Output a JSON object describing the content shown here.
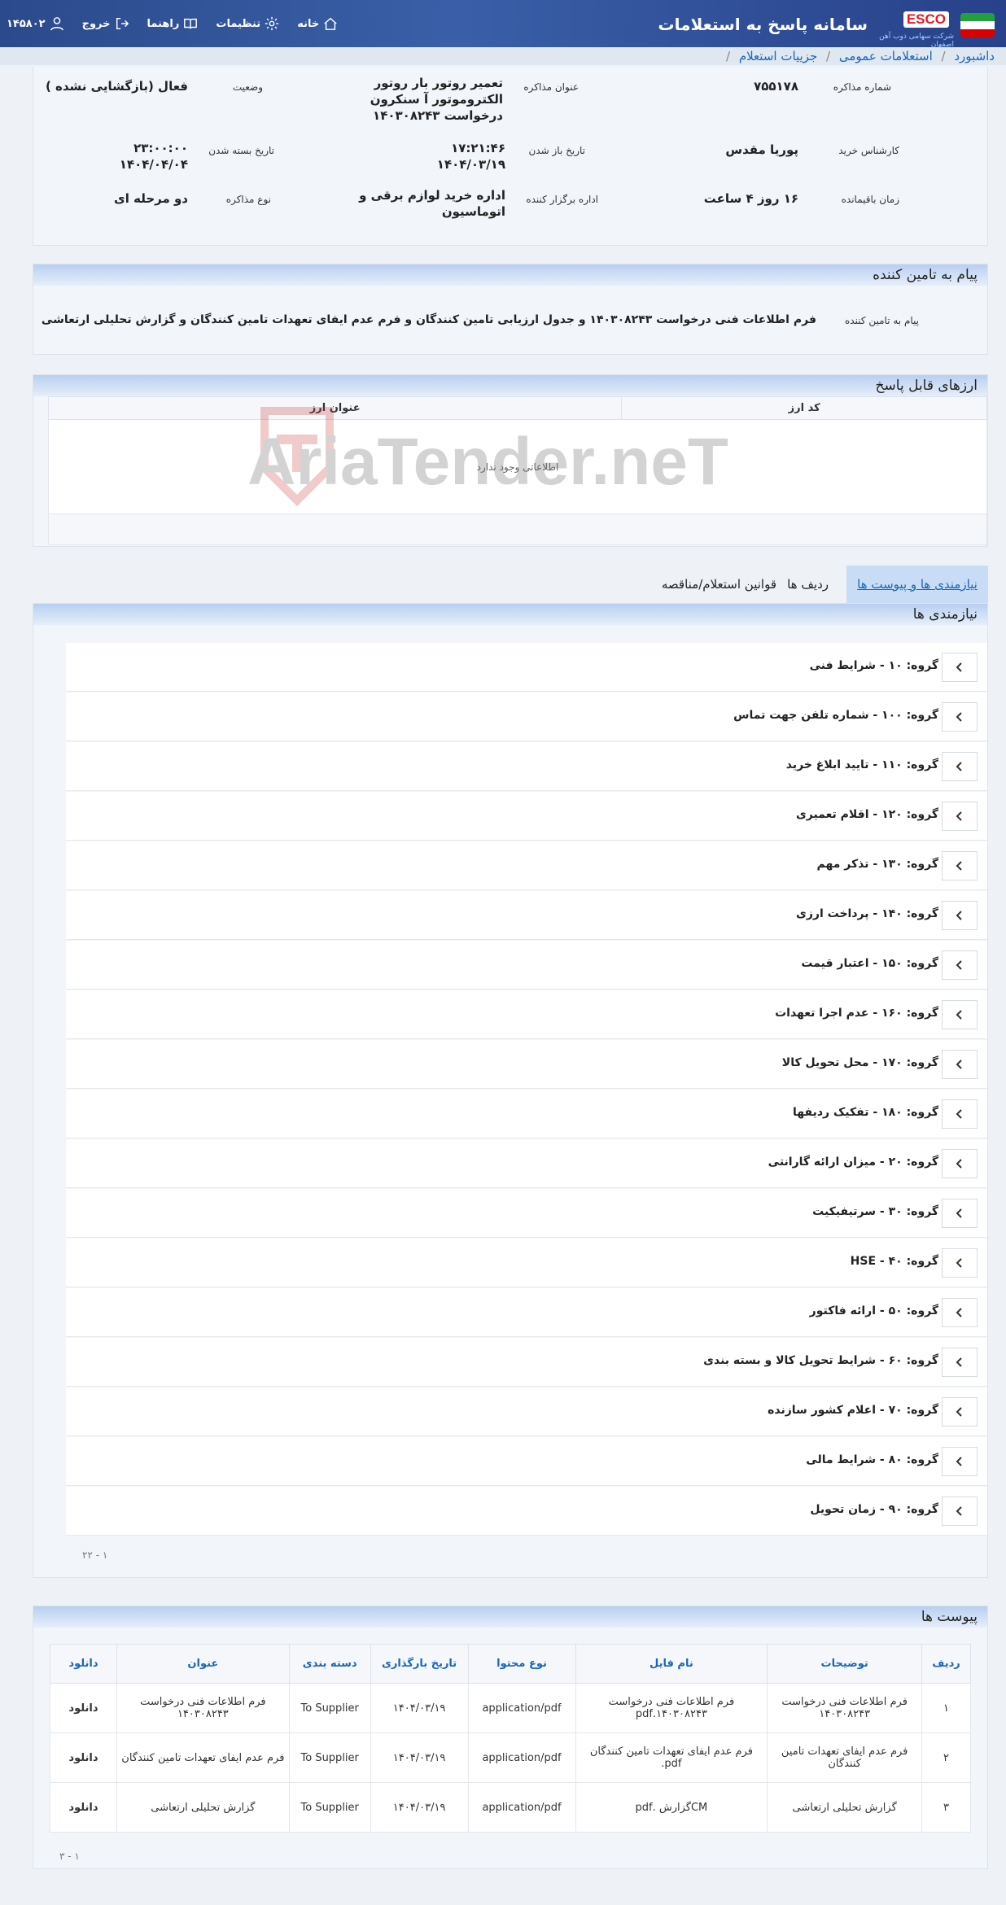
{
  "header": {
    "title": "سامانه پاسخ به استعلامات",
    "logo_text": "ESCO",
    "logo_subtitle": "شرکت سهامی ذوب آهن اصفهان",
    "nav": {
      "home": "خانه",
      "settings": "تنظیمات",
      "guide": "راهنما",
      "logout": "خروج",
      "user": "۱۴۵۸۰۲"
    }
  },
  "breadcrumb": {
    "dashboard": "داشبورد",
    "general": "استعلامات عمومی",
    "details": "جزییات استعلام",
    "sep": "/"
  },
  "info": {
    "num_label": "شماره مذاکره",
    "num": "۷۵۵۱۷۸",
    "title_label": "عنوان مذاکره",
    "title": "تعمیر روتور بار روتور الکتروموتور آ سنکرون درخواست ۱۴۰۳۰۸۲۴۳",
    "status_label": "وضعیت",
    "status": "فعال (بازگشایی نشده )",
    "expert_label": "کارشناس خرید",
    "expert": "پوریا مقدس",
    "open_label": "تاریخ باز شدن",
    "open_time": "۱۷:۲۱:۴۶",
    "open_date": "۱۴۰۴/۰۳/۱۹",
    "close_label": "تاریخ بسته شدن",
    "close_time": "۲۳:۰۰:۰۰",
    "close_date": "۱۴۰۴/۰۴/۰۴",
    "remain_label": "زمان باقیمانده",
    "remain": "۱۶ روز ۴ ساعت",
    "dept_label": "اداره برگزار کننده",
    "dept": "اداره خرید لوازم برقی و اتوماسیون",
    "type_label": "نوع مذاکره",
    "type": "دو مرحله ای"
  },
  "message": {
    "heading": "پیام به تامین کننده",
    "label": "پیام به تامین کننده",
    "text": "فرم اطلاعات فنی درخواست ۱۴۰۳۰۸۲۴۳ و جدول ارزیابی تامین کنندگان و فرم عدم ایفای تعهدات تامین کنندگان و گزارش تحلیلی ارتعاشی"
  },
  "currency": {
    "heading": "ارزهای قابل پاسخ",
    "col_code": "کد ارز",
    "col_title": "عنوان ارز",
    "empty": "اطلاعاتی وجود ندارد"
  },
  "watermark": "AriaTender.neT",
  "tabs": [
    "نیازمندی ها و پیوست ها",
    "ردیف ها",
    "قوانین استعلام/مناقصه"
  ],
  "requirements": {
    "heading": "نیازمندی ها",
    "groups": [
      "گروه: ۱۰ - شرایط فنی",
      "گروه: ۱۰۰ - شماره تلفن جهت تماس",
      "گروه: ۱۱۰ - تایید ابلاغ خرید",
      "گروه: ۱۲۰ - اقلام تعمیری",
      "گروه: ۱۳۰ - تذکر مهم",
      "گروه: ۱۴۰ - پرداخت ارزی",
      "گروه: ۱۵۰ - اعتبار قیمت",
      "گروه: ۱۶۰ - عدم اجرا تعهدات",
      "گروه: ۱۷۰ - محل تحویل کالا",
      "گروه: ۱۸۰ - تفکیک ردیفها",
      "گروه: ۲۰ - میزان ارائه گارانتی",
      "گروه: ۳۰ - سرتیفیکیت",
      "گروه: ۴۰ - HSE",
      "گروه: ۵۰ - ارائه فاکتور",
      "گروه: ۶۰ - شرایط تحویل کالا و بسته بندی",
      "گروه: ۷۰ - اعلام کشور سازنده",
      "گروه: ۸۰ - شرایط مالی",
      "گروه: ۹۰ - زمان تحویل"
    ],
    "pager": "۱ - ۲۲"
  },
  "attachments": {
    "heading": "پیوست ها",
    "cols": [
      "ردیف",
      "توضیحات",
      "نام فایل",
      "نوع محتوا",
      "تاریخ بارگذاری",
      "دسته بندی",
      "عنوان",
      "دانلود"
    ],
    "rows": [
      [
        "۱",
        "فرم اطلاعات فنی درخواست ۱۴۰۳۰۸۲۴۳",
        "فرم اطلاعات فنی درخواست ۱۴۰۳۰۸۲۴۳.pdf",
        "application/pdf",
        "۱۴۰۴/۰۳/۱۹",
        "To Supplier",
        "فرم اطلاعات فنی درخواست ۱۴۰۳۰۸۲۴۳",
        "دانلود"
      ],
      [
        "۲",
        "فرم عدم ایفای تعهدات تامین کنندگان",
        "فرم عدم ایفای تعهدات تامین کنندگان pdf.",
        "application/pdf",
        "۱۴۰۴/۰۳/۱۹",
        "To Supplier",
        "فرم عدم ایفای تعهدات تامین کنندگان",
        "دانلود"
      ],
      [
        "۳",
        "گزارش تحلیلی ارتعاشی",
        "CMگزارش .pdf",
        "application/pdf",
        "۱۴۰۴/۰۳/۱۹",
        "To Supplier",
        "گزارش تحلیلی ارتعاشی",
        "دانلود"
      ]
    ],
    "pager": "۱ - ۳"
  }
}
